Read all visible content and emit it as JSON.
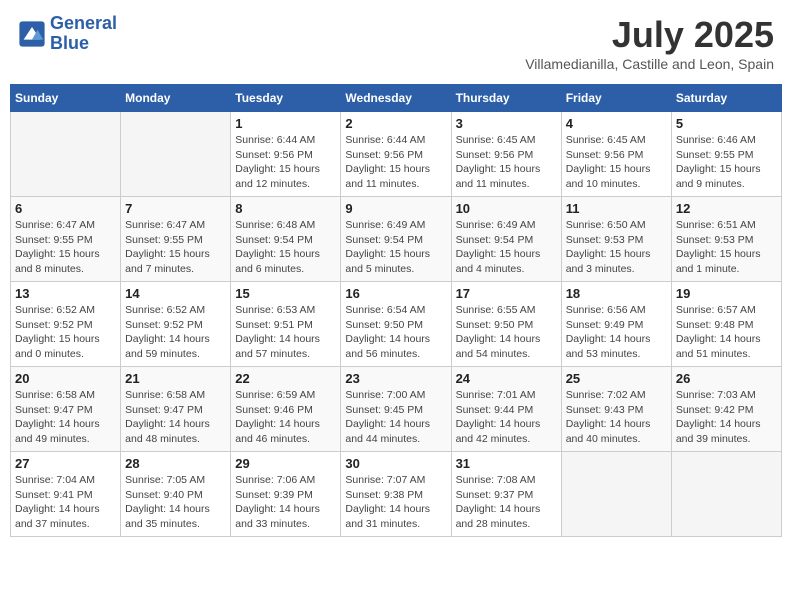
{
  "header": {
    "logo_line1": "General",
    "logo_line2": "Blue",
    "month": "July 2025",
    "location": "Villamedianilla, Castille and Leon, Spain"
  },
  "days_of_week": [
    "Sunday",
    "Monday",
    "Tuesday",
    "Wednesday",
    "Thursday",
    "Friday",
    "Saturday"
  ],
  "weeks": [
    [
      {
        "day": "",
        "info": ""
      },
      {
        "day": "",
        "info": ""
      },
      {
        "day": "1",
        "info": "Sunrise: 6:44 AM\nSunset: 9:56 PM\nDaylight: 15 hours and 12 minutes."
      },
      {
        "day": "2",
        "info": "Sunrise: 6:44 AM\nSunset: 9:56 PM\nDaylight: 15 hours and 11 minutes."
      },
      {
        "day": "3",
        "info": "Sunrise: 6:45 AM\nSunset: 9:56 PM\nDaylight: 15 hours and 11 minutes."
      },
      {
        "day": "4",
        "info": "Sunrise: 6:45 AM\nSunset: 9:56 PM\nDaylight: 15 hours and 10 minutes."
      },
      {
        "day": "5",
        "info": "Sunrise: 6:46 AM\nSunset: 9:55 PM\nDaylight: 15 hours and 9 minutes."
      }
    ],
    [
      {
        "day": "6",
        "info": "Sunrise: 6:47 AM\nSunset: 9:55 PM\nDaylight: 15 hours and 8 minutes."
      },
      {
        "day": "7",
        "info": "Sunrise: 6:47 AM\nSunset: 9:55 PM\nDaylight: 15 hours and 7 minutes."
      },
      {
        "day": "8",
        "info": "Sunrise: 6:48 AM\nSunset: 9:54 PM\nDaylight: 15 hours and 6 minutes."
      },
      {
        "day": "9",
        "info": "Sunrise: 6:49 AM\nSunset: 9:54 PM\nDaylight: 15 hours and 5 minutes."
      },
      {
        "day": "10",
        "info": "Sunrise: 6:49 AM\nSunset: 9:54 PM\nDaylight: 15 hours and 4 minutes."
      },
      {
        "day": "11",
        "info": "Sunrise: 6:50 AM\nSunset: 9:53 PM\nDaylight: 15 hours and 3 minutes."
      },
      {
        "day": "12",
        "info": "Sunrise: 6:51 AM\nSunset: 9:53 PM\nDaylight: 15 hours and 1 minute."
      }
    ],
    [
      {
        "day": "13",
        "info": "Sunrise: 6:52 AM\nSunset: 9:52 PM\nDaylight: 15 hours and 0 minutes."
      },
      {
        "day": "14",
        "info": "Sunrise: 6:52 AM\nSunset: 9:52 PM\nDaylight: 14 hours and 59 minutes."
      },
      {
        "day": "15",
        "info": "Sunrise: 6:53 AM\nSunset: 9:51 PM\nDaylight: 14 hours and 57 minutes."
      },
      {
        "day": "16",
        "info": "Sunrise: 6:54 AM\nSunset: 9:50 PM\nDaylight: 14 hours and 56 minutes."
      },
      {
        "day": "17",
        "info": "Sunrise: 6:55 AM\nSunset: 9:50 PM\nDaylight: 14 hours and 54 minutes."
      },
      {
        "day": "18",
        "info": "Sunrise: 6:56 AM\nSunset: 9:49 PM\nDaylight: 14 hours and 53 minutes."
      },
      {
        "day": "19",
        "info": "Sunrise: 6:57 AM\nSunset: 9:48 PM\nDaylight: 14 hours and 51 minutes."
      }
    ],
    [
      {
        "day": "20",
        "info": "Sunrise: 6:58 AM\nSunset: 9:47 PM\nDaylight: 14 hours and 49 minutes."
      },
      {
        "day": "21",
        "info": "Sunrise: 6:58 AM\nSunset: 9:47 PM\nDaylight: 14 hours and 48 minutes."
      },
      {
        "day": "22",
        "info": "Sunrise: 6:59 AM\nSunset: 9:46 PM\nDaylight: 14 hours and 46 minutes."
      },
      {
        "day": "23",
        "info": "Sunrise: 7:00 AM\nSunset: 9:45 PM\nDaylight: 14 hours and 44 minutes."
      },
      {
        "day": "24",
        "info": "Sunrise: 7:01 AM\nSunset: 9:44 PM\nDaylight: 14 hours and 42 minutes."
      },
      {
        "day": "25",
        "info": "Sunrise: 7:02 AM\nSunset: 9:43 PM\nDaylight: 14 hours and 40 minutes."
      },
      {
        "day": "26",
        "info": "Sunrise: 7:03 AM\nSunset: 9:42 PM\nDaylight: 14 hours and 39 minutes."
      }
    ],
    [
      {
        "day": "27",
        "info": "Sunrise: 7:04 AM\nSunset: 9:41 PM\nDaylight: 14 hours and 37 minutes."
      },
      {
        "day": "28",
        "info": "Sunrise: 7:05 AM\nSunset: 9:40 PM\nDaylight: 14 hours and 35 minutes."
      },
      {
        "day": "29",
        "info": "Sunrise: 7:06 AM\nSunset: 9:39 PM\nDaylight: 14 hours and 33 minutes."
      },
      {
        "day": "30",
        "info": "Sunrise: 7:07 AM\nSunset: 9:38 PM\nDaylight: 14 hours and 31 minutes."
      },
      {
        "day": "31",
        "info": "Sunrise: 7:08 AM\nSunset: 9:37 PM\nDaylight: 14 hours and 28 minutes."
      },
      {
        "day": "",
        "info": ""
      },
      {
        "day": "",
        "info": ""
      }
    ]
  ]
}
